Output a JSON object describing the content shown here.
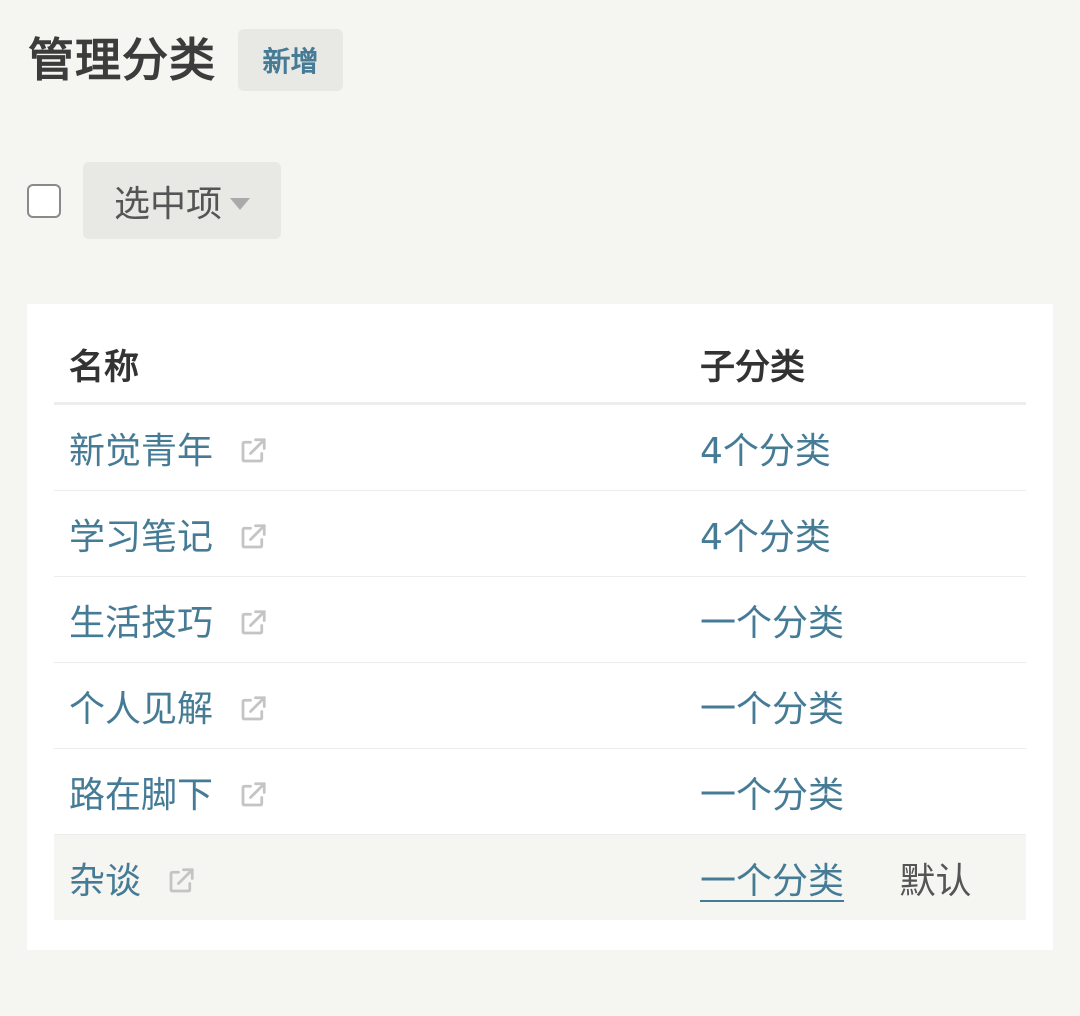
{
  "header": {
    "title": "管理分类",
    "add_label": "新增"
  },
  "toolbar": {
    "bulk_label": "选中项"
  },
  "table": {
    "columns": [
      "名称",
      "子分类"
    ],
    "rows": [
      {
        "name": "新觉青年",
        "children": "4个分类"
      },
      {
        "name": "学习笔记",
        "children": "4个分类"
      },
      {
        "name": "生活技巧",
        "children": "一个分类"
      },
      {
        "name": "个人见解",
        "children": "一个分类"
      },
      {
        "name": "路在脚下",
        "children": "一个分类"
      },
      {
        "name": "杂谈",
        "children": "一个分类",
        "badge": "默认"
      }
    ]
  },
  "colors": {
    "accent": "#467b96",
    "background": "#f5f5f1",
    "icon": "#c4c4c4"
  },
  "icons": {
    "external": "external-link-icon",
    "caret": "caret-down-icon"
  }
}
